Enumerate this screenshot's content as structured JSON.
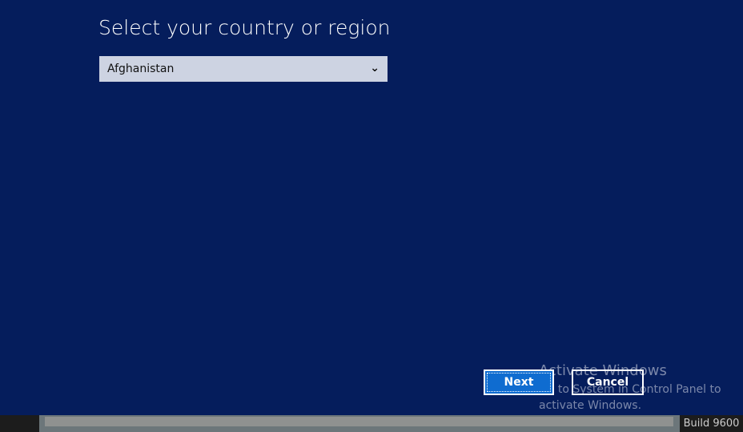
{
  "title": "Select your country or region",
  "country_select": {
    "value": "Afghanistan"
  },
  "buttons": {
    "next": "Next",
    "cancel": "Cancel"
  },
  "watermark": {
    "heading": "Activate Windows",
    "text": "Go to System in Control Panel to activate Windows."
  },
  "status": {
    "build": "Build 9600",
    "progress_percent": 100
  },
  "colors": {
    "background": "#051d5c",
    "accent": "#0f6cd0"
  }
}
